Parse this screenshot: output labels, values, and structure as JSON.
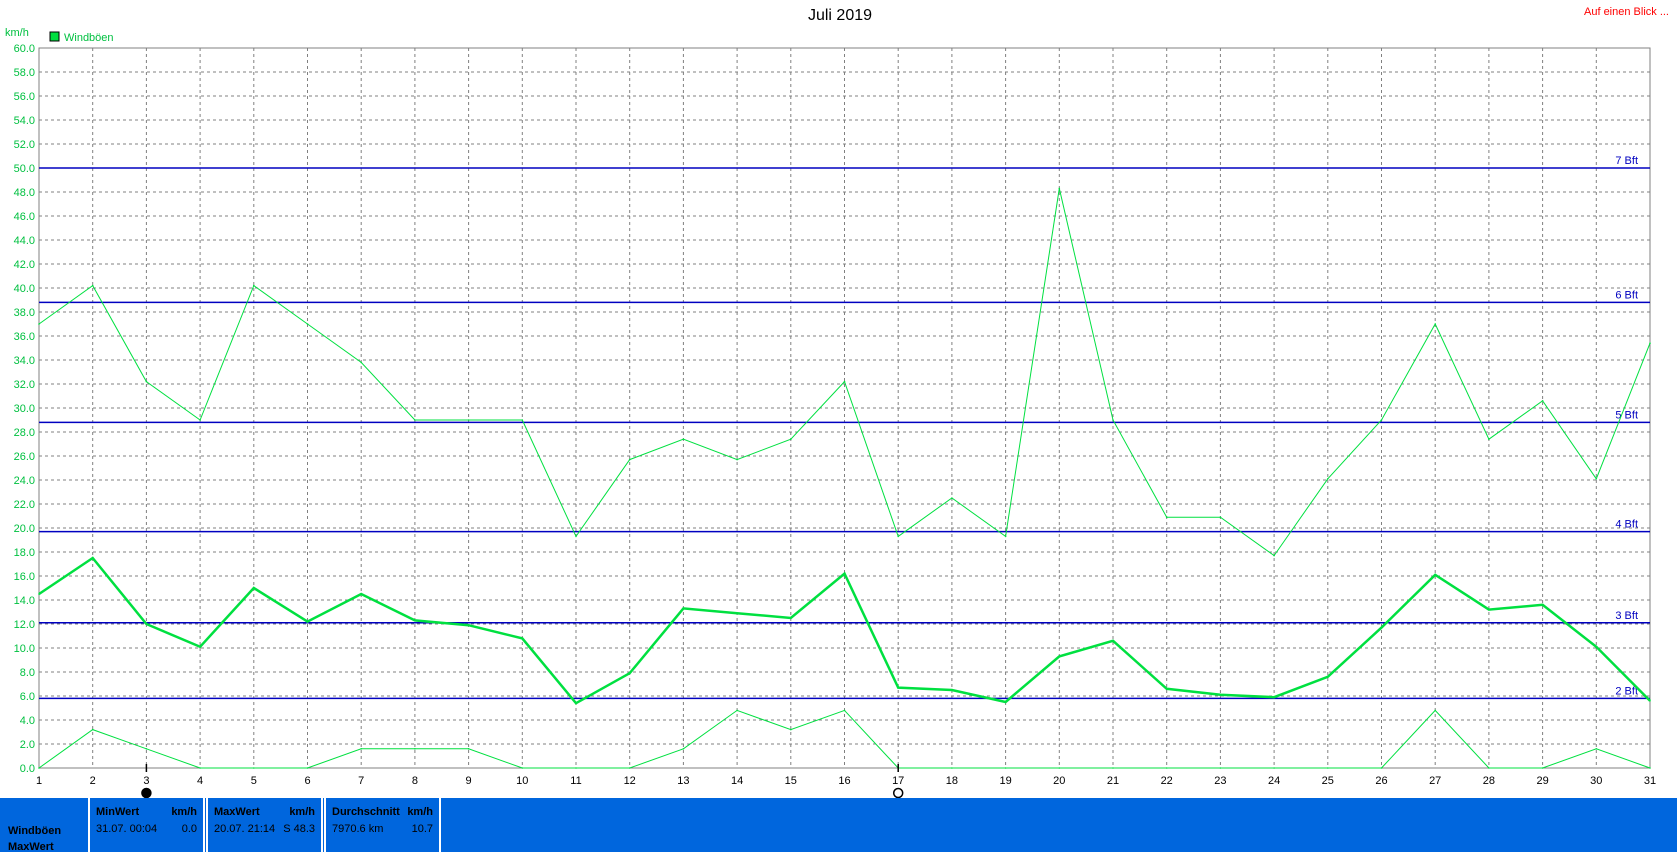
{
  "header": {
    "title": "Juli 2019",
    "link": "Auf einen Blick ..."
  },
  "chart_data": {
    "type": "line",
    "title": "Juli 2019",
    "ylabel": "km/h",
    "ylim": [
      0,
      60
    ],
    "ytick_step": 2,
    "xlim": [
      1,
      31
    ],
    "x": [
      1,
      2,
      3,
      4,
      5,
      6,
      7,
      8,
      9,
      10,
      11,
      12,
      13,
      14,
      15,
      16,
      17,
      18,
      19,
      20,
      21,
      22,
      23,
      24,
      25,
      26,
      27,
      28,
      29,
      30,
      31
    ],
    "legend": [
      "Windböen"
    ],
    "legend_position": "top-left",
    "grid": true,
    "series": [
      {
        "name": "Windböen",
        "role": "max",
        "color": "#00e040",
        "values": [
          37.0,
          40.2,
          32.2,
          29.0,
          40.2,
          37.0,
          33.8,
          29.0,
          29.0,
          29.0,
          19.3,
          25.7,
          27.4,
          25.7,
          27.4,
          32.2,
          19.3,
          22.5,
          19.3,
          48.3,
          29.0,
          20.9,
          20.9,
          17.7,
          24.1,
          29.0,
          37.0,
          27.4,
          30.6,
          24.1,
          35.4
        ]
      },
      {
        "role": "mean",
        "color": "#00e040",
        "values": [
          14.5,
          17.5,
          12.0,
          10.1,
          15.0,
          12.2,
          14.5,
          12.3,
          11.9,
          10.8,
          5.4,
          7.9,
          13.3,
          12.9,
          12.5,
          16.2,
          6.7,
          6.5,
          5.5,
          9.3,
          10.6,
          6.6,
          6.1,
          5.9,
          7.6,
          11.7,
          16.1,
          13.2,
          13.6,
          10.1,
          5.6
        ]
      },
      {
        "role": "min",
        "color": "#00e040",
        "values": [
          0.0,
          3.2,
          1.6,
          0.0,
          0.0,
          0.0,
          1.6,
          1.6,
          1.6,
          0.0,
          0.0,
          0.0,
          1.6,
          4.8,
          3.2,
          4.8,
          0.0,
          0.0,
          0.0,
          0.0,
          0.0,
          0.0,
          0.0,
          0.0,
          0.0,
          0.0,
          4.8,
          0.0,
          0.0,
          1.6,
          0.0
        ]
      }
    ],
    "reference_lines": [
      {
        "value": 5.8,
        "label": "2 Bft"
      },
      {
        "value": 12.1,
        "label": "3 Bft"
      },
      {
        "value": 19.7,
        "label": "4 Bft"
      },
      {
        "value": 28.8,
        "label": "5 Bft"
      },
      {
        "value": 38.8,
        "label": "6 Bft"
      },
      {
        "value": 50.0,
        "label": "7 Bft"
      }
    ],
    "markers": [
      {
        "x": 3,
        "symbol": "filled-circle"
      },
      {
        "x": 17,
        "symbol": "open-circle"
      }
    ]
  },
  "stats": {
    "row_labels": [
      "Windböen",
      "MaxWert"
    ],
    "boxes": [
      {
        "header": "MinWert",
        "unit": "km/h",
        "value_left": "31.07.  00:04",
        "value_right": "0.0"
      },
      {
        "header": "MaxWert",
        "unit": "km/h",
        "value_left": "20.07.  21:14",
        "value_right": "S 48.3"
      },
      {
        "header": "Durchschnitt",
        "unit": "km/h",
        "value_left": "7970.6 km",
        "value_right": "10.7"
      }
    ]
  },
  "colors": {
    "series": "#00e040",
    "reference": "#0000c0",
    "stats_bar": "#0066dd",
    "link": "#ff0000"
  }
}
